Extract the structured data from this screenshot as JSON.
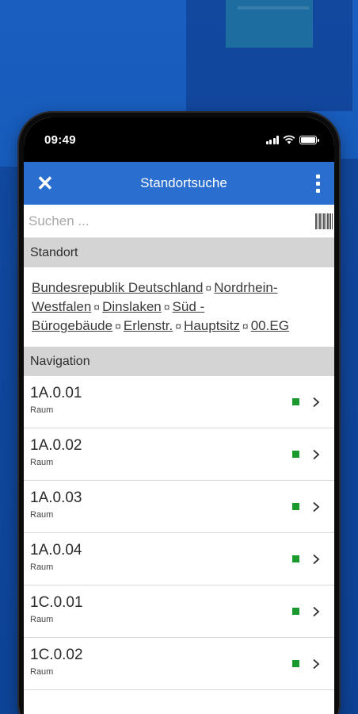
{
  "status_bar": {
    "time": "09:49"
  },
  "app_bar": {
    "title": "Standortsuche"
  },
  "search": {
    "placeholder": "Suchen ..."
  },
  "standort": {
    "header": "Standort",
    "path_1": "Bundesrepublik Deutschland",
    "path_2": "Nordrhein-Westfalen",
    "path_3": "Dinslaken",
    "path_4": "Süd - Bürogebäude",
    "path_5": "Erlenstr.",
    "path_6": "Hauptsitz",
    "path_7": "00.EG",
    "separator": "¤"
  },
  "navigation": {
    "header": "Navigation",
    "items": [
      {
        "title": "1A.0.01",
        "subtitle": "Raum"
      },
      {
        "title": "1A.0.02",
        "subtitle": "Raum"
      },
      {
        "title": "1A.0.03",
        "subtitle": "Raum"
      },
      {
        "title": "1A.0.04",
        "subtitle": "Raum"
      },
      {
        "title": "1C.0.01",
        "subtitle": "Raum"
      },
      {
        "title": "1C.0.02",
        "subtitle": "Raum"
      }
    ]
  },
  "colors": {
    "app_bar": "#2a6fd0",
    "status_indicator": "#1a9a2c",
    "section_header": "#d4d4d4",
    "background": "#1559b8"
  },
  "icons": {
    "close": "close-icon",
    "menu": "kebab-menu-icon",
    "barcode": "barcode-scan-icon",
    "chevron": "chevron-right-icon"
  }
}
